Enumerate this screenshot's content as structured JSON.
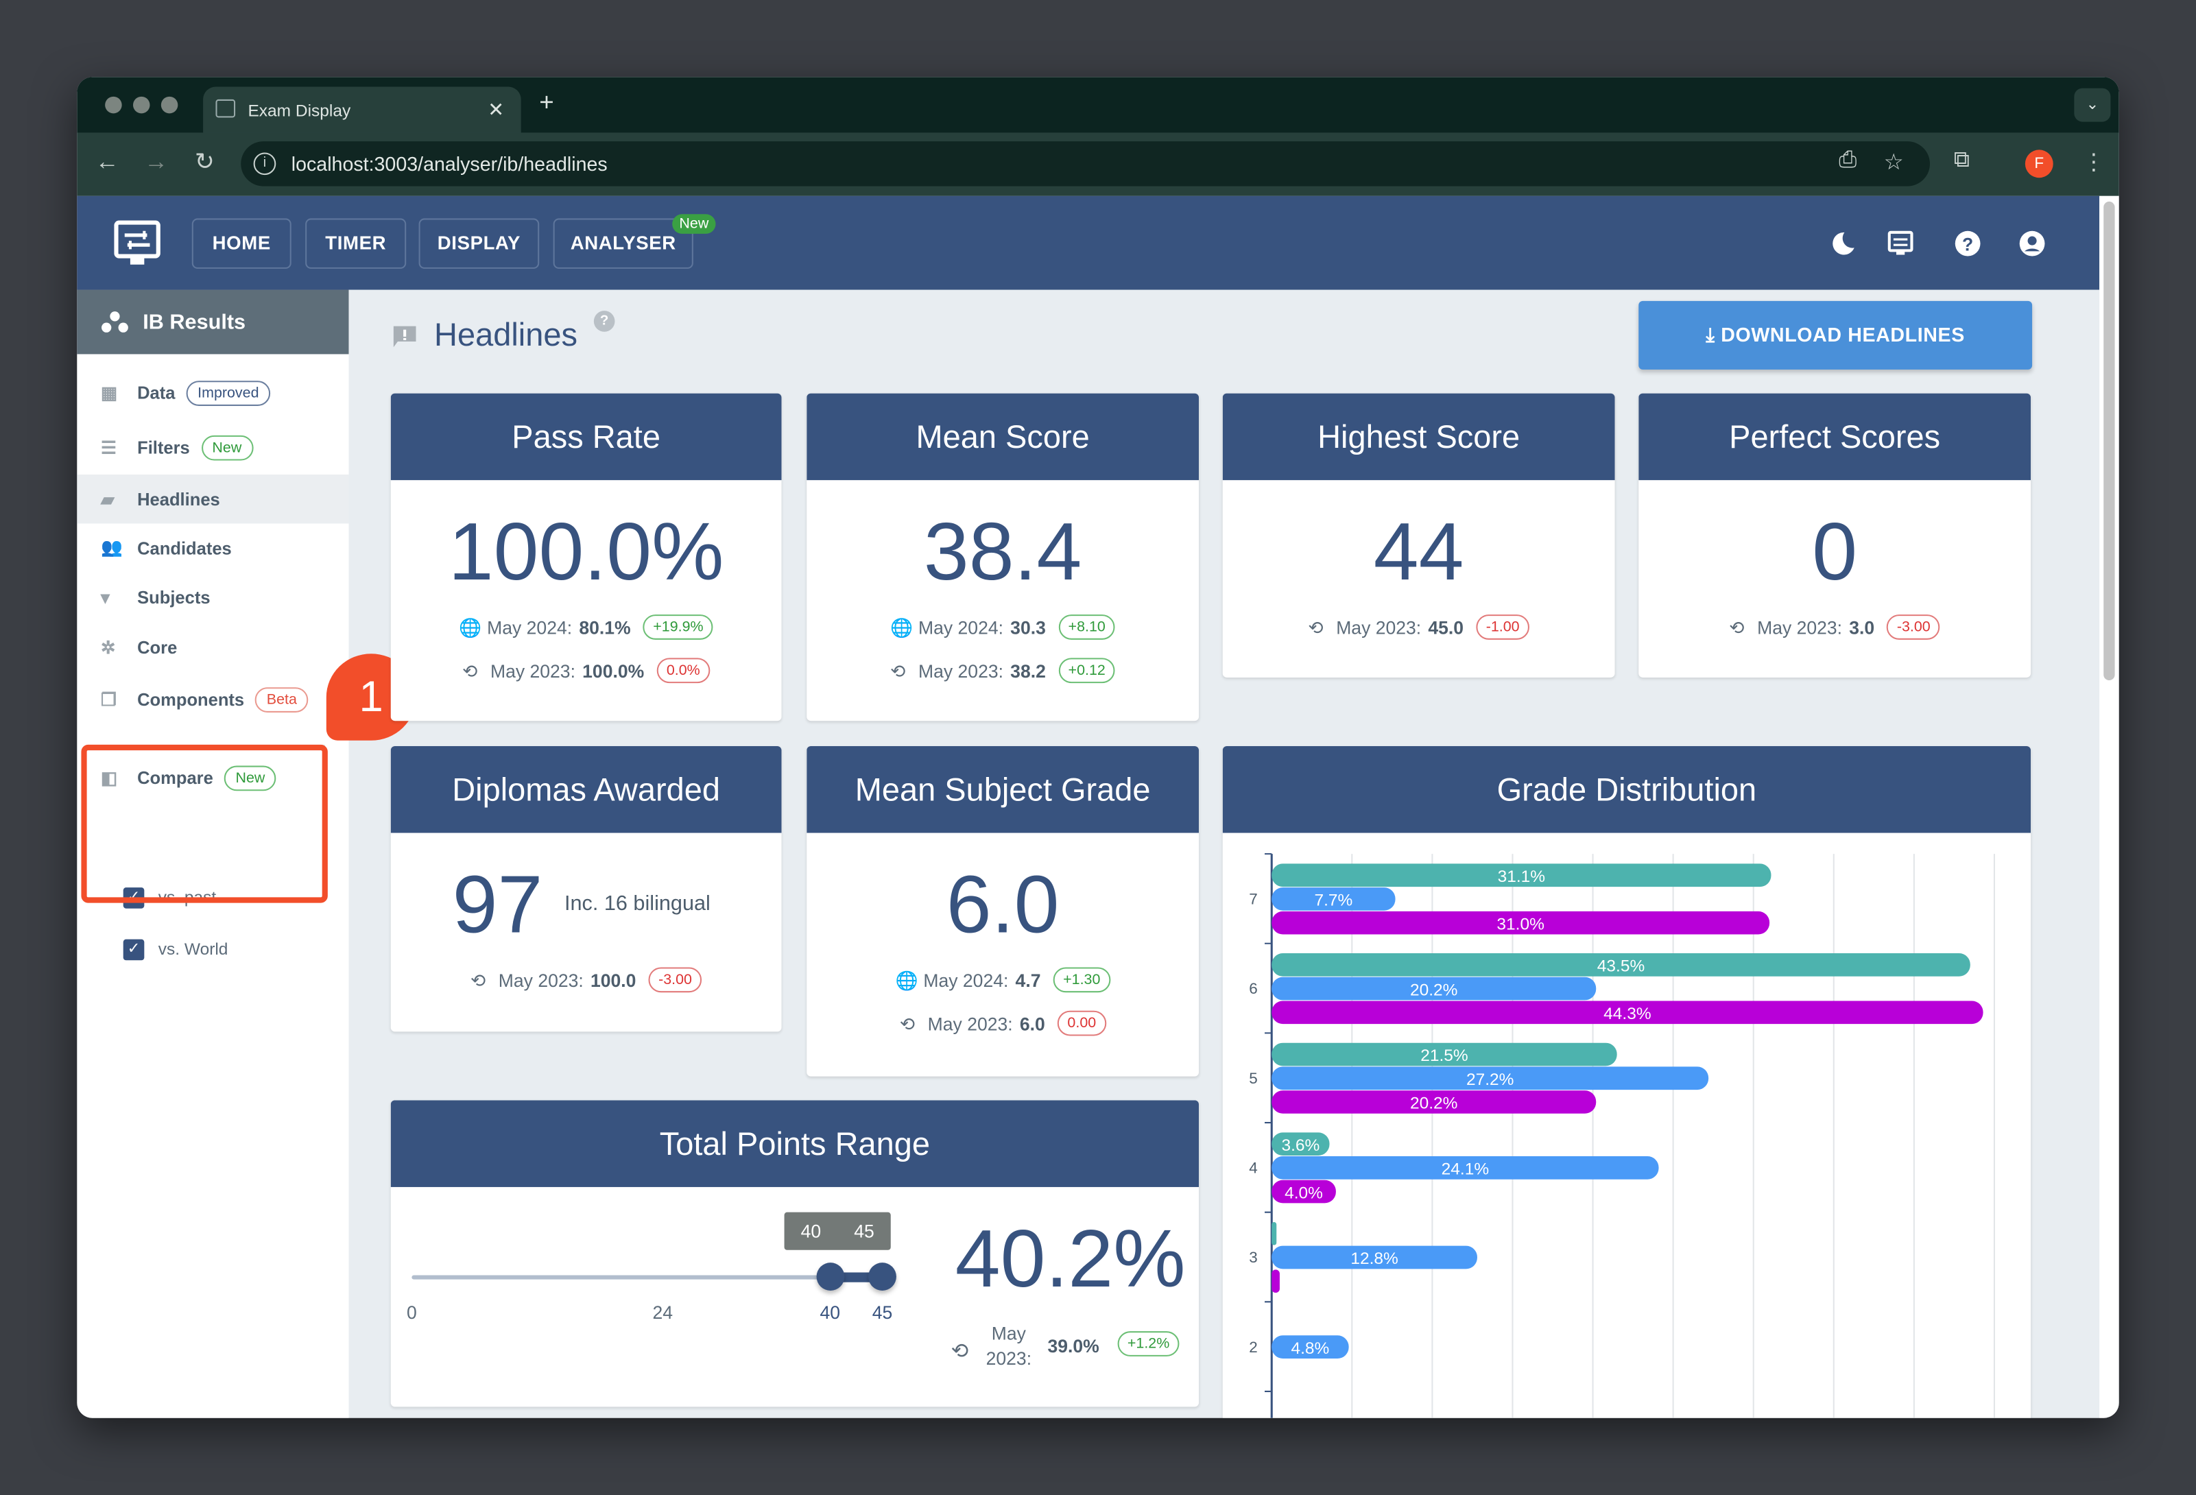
{
  "browser": {
    "tab_title": "Exam Display",
    "url": "localhost:3003/analyser/ib/headlines",
    "profile_initial": "F"
  },
  "app": {
    "nav": [
      "HOME",
      "TIMER",
      "DISPLAY",
      "ANALYSER"
    ],
    "analyser_badge": "New"
  },
  "sidebar": {
    "title": "IB Results",
    "items": [
      {
        "label": "Data",
        "badge": "Improved",
        "icon": "table-icon"
      },
      {
        "label": "Filters",
        "badge": "New",
        "icon": "filter-icon"
      },
      {
        "label": "Headlines",
        "icon": "feedback-icon",
        "active": true
      },
      {
        "label": "Candidates",
        "icon": "people-icon"
      },
      {
        "label": "Subjects",
        "icon": "reader-icon"
      },
      {
        "label": "Core",
        "icon": "hub-icon"
      },
      {
        "label": "Components",
        "badge": "Beta",
        "icon": "documents-icon"
      }
    ],
    "compare": {
      "label": "Compare",
      "badge": "New",
      "options": [
        {
          "label": "vs. past",
          "checked": true
        },
        {
          "label": "vs. World",
          "checked": true
        }
      ]
    },
    "callout_number": "1"
  },
  "page": {
    "title": "Headlines",
    "download_label": "DOWNLOAD HEADLINES"
  },
  "cards": {
    "pass_rate": {
      "title": "Pass Rate",
      "value": "100.0%",
      "world_label": "May 2024:",
      "world_value": "80.1%",
      "world_delta": "+19.9%",
      "past_label": "May 2023:",
      "past_value": "100.0%",
      "past_delta": "0.0%"
    },
    "mean_score": {
      "title": "Mean Score",
      "value": "38.4",
      "world_label": "May 2024:",
      "world_value": "30.3",
      "world_delta": "+8.10",
      "past_label": "May 2023:",
      "past_value": "38.2",
      "past_delta": "+0.12"
    },
    "highest_score": {
      "title": "Highest Score",
      "value": "44",
      "past_label": "May 2023:",
      "past_value": "45.0",
      "past_delta": "-1.00"
    },
    "perfect_scores": {
      "title": "Perfect Scores",
      "value": "0",
      "past_label": "May 2023:",
      "past_value": "3.0",
      "past_delta": "-3.00"
    },
    "diplomas": {
      "title": "Diplomas Awarded",
      "value": "97",
      "note": "Inc. 16 bilingual",
      "past_label": "May 2023:",
      "past_value": "100.0",
      "past_delta": "-3.00"
    },
    "mean_grade": {
      "title": "Mean Subject Grade",
      "value": "6.0",
      "world_label": "May 2024:",
      "world_value": "4.7",
      "world_delta": "+1.30",
      "past_label": "May 2023:",
      "past_value": "6.0",
      "past_delta": "0.00"
    },
    "points_range": {
      "title": "Total Points Range",
      "slider_min": 0,
      "slider_max": 45,
      "range_low": 40,
      "range_high": 45,
      "tick_labels": [
        "0",
        "24",
        "40",
        "45"
      ],
      "tooltip_low": "40",
      "tooltip_high": "45",
      "value": "40.2%",
      "past_label_1": "May",
      "past_label_2": "2023:",
      "past_value": "39.0%",
      "past_delta": "+1.2%"
    }
  },
  "chart_data": {
    "type": "bar",
    "orientation": "horizontal",
    "title": "Grade Distribution",
    "categories": [
      "7",
      "6",
      "5",
      "4",
      "3",
      "2"
    ],
    "xlim": [
      0,
      45
    ],
    "grid": true,
    "colors": [
      "#4db3ae",
      "#4a9af7",
      "#b800d8"
    ],
    "series": [
      {
        "values": [
          31.1,
          43.5,
          21.5,
          3.6,
          0.3,
          null
        ],
        "labels": [
          "31.1%",
          "43.5%",
          "21.5%",
          "3.6%",
          "",
          ""
        ]
      },
      {
        "values": [
          7.7,
          20.2,
          27.2,
          24.1,
          12.8,
          4.8
        ],
        "labels": [
          "7.7%",
          "20.2%",
          "27.2%",
          "24.1%",
          "12.8%",
          "4.8%"
        ]
      },
      {
        "values": [
          31.0,
          44.3,
          20.2,
          4.0,
          0.5,
          null
        ],
        "labels": [
          "31.0%",
          "44.3%",
          "20.2%",
          "4.0%",
          "",
          ""
        ]
      }
    ]
  }
}
